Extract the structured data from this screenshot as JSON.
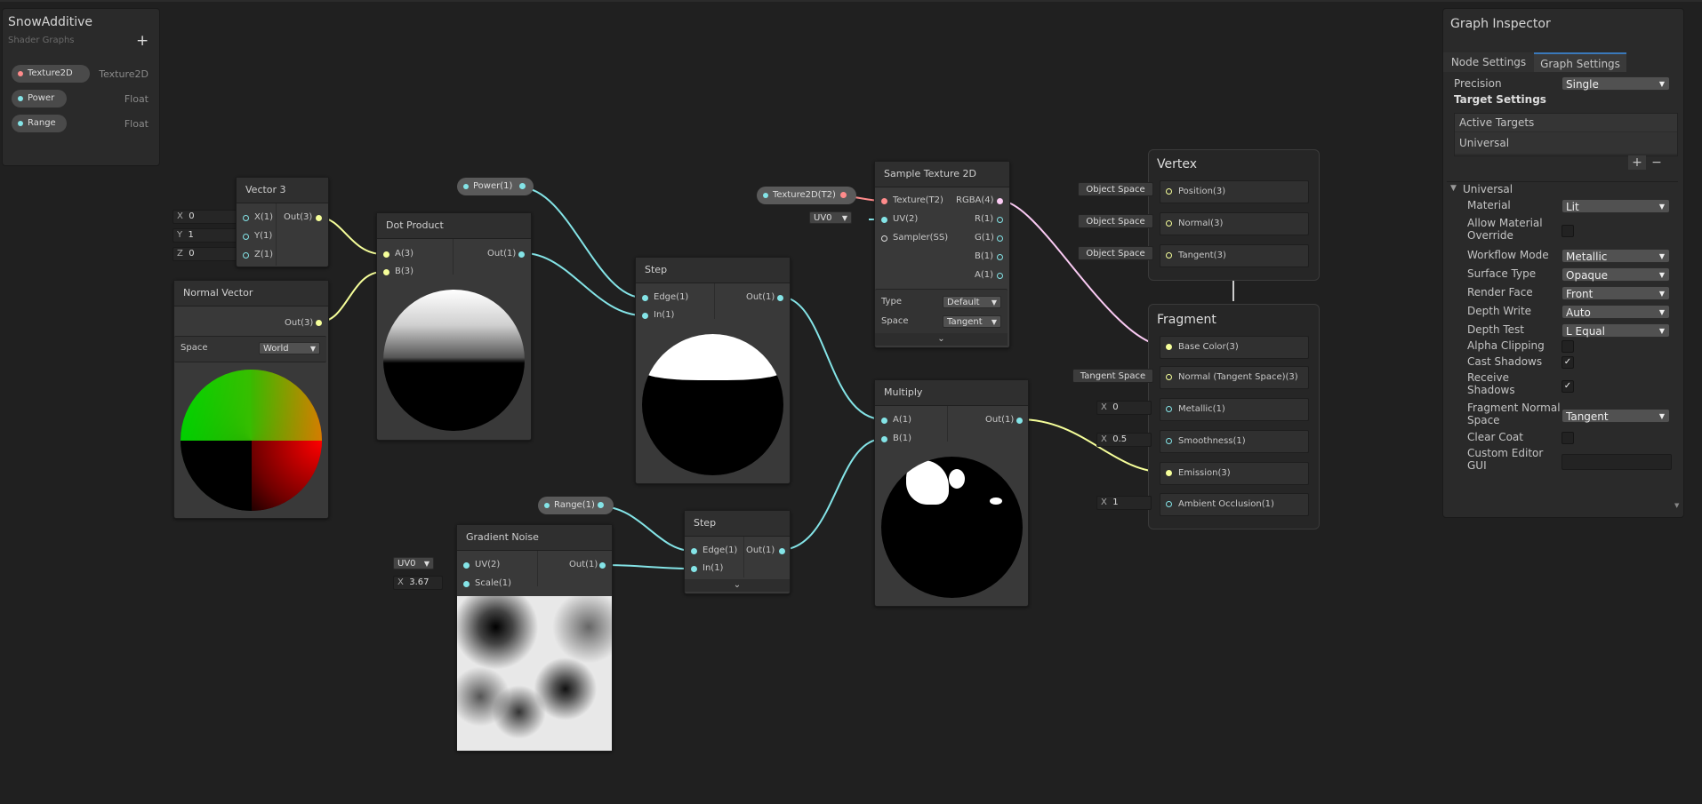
{
  "blackboard": {
    "title": "SnowAdditive",
    "subtitle": "Shader Graphs",
    "add_label": "+",
    "properties": [
      {
        "name": "Texture2D",
        "type": "Texture2D"
      },
      {
        "name": "Power",
        "type": "Float"
      },
      {
        "name": "Range",
        "type": "Float"
      }
    ]
  },
  "nodes": {
    "vector3": {
      "title": "Vector 3",
      "inputs": [
        {
          "axis": "X",
          "value": "0",
          "port": "X(1)"
        },
        {
          "axis": "Y",
          "value": "1",
          "port": "Y(1)"
        },
        {
          "axis": "Z",
          "value": "0",
          "port": "Z(1)"
        }
      ],
      "output": "Out(3)"
    },
    "normal_vector": {
      "title": "Normal Vector",
      "output": "Out(3)",
      "space_label": "Space",
      "space_value": "World"
    },
    "dot_product": {
      "title": "Dot Product",
      "in_a": "A(3)",
      "in_b": "B(3)",
      "output": "Out(1)"
    },
    "power_prop": {
      "label": "Power(1)"
    },
    "step1": {
      "title": "Step",
      "edge": "Edge(1)",
      "in": "In(1)",
      "output": "Out(1)"
    },
    "texture_prop": {
      "label": "Texture2D(T2)"
    },
    "sample_texture": {
      "title": "Sample Texture 2D",
      "uv_default": "UV0",
      "inputs": [
        "Texture(T2)",
        "UV(2)",
        "Sampler(SS)"
      ],
      "outputs": [
        "RGBA(4)",
        "R(1)",
        "G(1)",
        "B(1)",
        "A(1)"
      ],
      "type_label": "Type",
      "type_value": "Default",
      "space_label": "Space",
      "space_value": "Tangent"
    },
    "multiply": {
      "title": "Multiply",
      "in_a": "A(1)",
      "in_b": "B(1)",
      "output": "Out(1)"
    },
    "range_prop": {
      "label": "Range(1)"
    },
    "gradient_noise": {
      "title": "Gradient Noise",
      "uv_default": "UV0",
      "scale_axis": "X",
      "scale_value": "3.67",
      "in_uv": "UV(2)",
      "in_scale": "Scale(1)",
      "output": "Out(1)"
    },
    "step2": {
      "title": "Step",
      "edge": "Edge(1)",
      "in": "In(1)",
      "output": "Out(1)"
    }
  },
  "master": {
    "vertex": {
      "title": "Vertex",
      "ports": [
        {
          "space": "Object Space",
          "label": "Position(3)"
        },
        {
          "space": "Object Space",
          "label": "Normal(3)"
        },
        {
          "space": "Object Space",
          "label": "Tangent(3)"
        }
      ]
    },
    "fragment": {
      "title": "Fragment",
      "ports": [
        {
          "label": "Base Color(3)",
          "input": ""
        },
        {
          "label": "Normal (Tangent Space)(3)",
          "input": "Tangent Space"
        },
        {
          "label": "Metallic(1)",
          "axis": "X",
          "value": "0"
        },
        {
          "label": "Smoothness(1)",
          "axis": "X",
          "value": "0.5"
        },
        {
          "label": "Emission(3)",
          "input": ""
        },
        {
          "label": "Ambient Occlusion(1)",
          "axis": "X",
          "value": "1"
        }
      ]
    }
  },
  "inspector": {
    "title": "Graph Inspector",
    "tabs": [
      "Node Settings",
      "Graph Settings"
    ],
    "active_tab": "Graph Settings",
    "precision_label": "Precision",
    "precision_value": "Single",
    "target_settings": "Target Settings",
    "active_targets": "Active Targets",
    "targets": [
      "Universal"
    ],
    "add_label": "+",
    "remove_label": "−",
    "section": "Universal",
    "rows": [
      {
        "label": "Material",
        "value": "Lit",
        "kind": "dropdown"
      },
      {
        "label": "Allow Material Override",
        "kind": "checkbox",
        "checked": false
      },
      {
        "label": "Workflow Mode",
        "value": "Metallic",
        "kind": "dropdown"
      },
      {
        "label": "Surface Type",
        "value": "Opaque",
        "kind": "dropdown"
      },
      {
        "label": "Render Face",
        "value": "Front",
        "kind": "dropdown"
      },
      {
        "label": "Depth Write",
        "value": "Auto",
        "kind": "dropdown"
      },
      {
        "label": "Depth Test",
        "value": "L Equal",
        "kind": "dropdown"
      },
      {
        "label": "Alpha Clipping",
        "kind": "checkbox",
        "checked": false
      },
      {
        "label": "Cast Shadows",
        "kind": "checkbox",
        "checked": true
      },
      {
        "label": "Receive Shadows",
        "kind": "checkbox",
        "checked": true
      },
      {
        "label": "Fragment Normal Space",
        "value": "Tangent",
        "kind": "dropdown"
      },
      {
        "label": "Clear Coat",
        "kind": "checkbox",
        "checked": false
      },
      {
        "label": "Custom Editor GUI",
        "kind": "text",
        "value": ""
      }
    ]
  },
  "colors": {
    "background": "#202020",
    "wire_float": "#84e4e7",
    "wire_vector3": "#f6ff9a",
    "wire_vector4": "#fbcbf4",
    "wire_texture": "#ff8b8b"
  },
  "check_mark": "✓"
}
